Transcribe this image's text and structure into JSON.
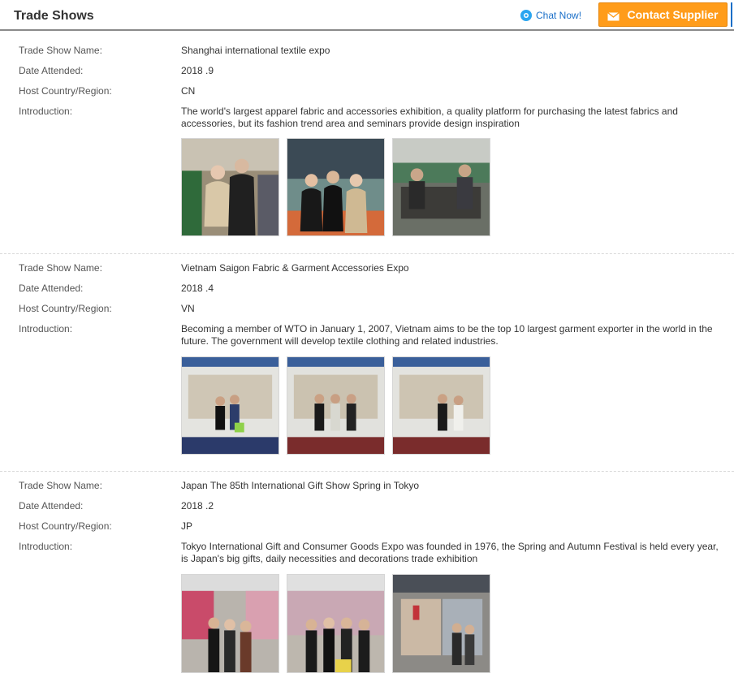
{
  "header": {
    "title": "Trade Shows",
    "chat_label": "Chat Now!",
    "contact_label": "Contact Supplier",
    "icons": {
      "chat": "chat-bubble-icon",
      "contact": "envelope-icon"
    },
    "colors": {
      "accent": "#ff9c1a",
      "link": "#1a6fc8"
    }
  },
  "labels": {
    "name": "Trade Show Name:",
    "date": "Date Attended:",
    "country": "Host Country/Region:",
    "intro": "Introduction:"
  },
  "shows": [
    {
      "name": "Shanghai international textile expo",
      "date": "2018 .9",
      "country": "CN",
      "intro": "The world's largest apparel fabric and accessories exhibition, a quality platform for purchasing the latest fabrics and accessories, but its fashion trend area and seminars provide design inspiration"
    },
    {
      "name": "Vietnam Saigon Fabric & Garment Accessories Expo",
      "date": "2018 .4",
      "country": "VN",
      "intro": "Becoming a member of WTO in January 1, 2007, Vietnam aims to be the top 10 largest garment exporter in the world in the future. The government will develop textile clothing and related industries."
    },
    {
      "name": "Japan The 85th International Gift Show Spring in Tokyo",
      "date": "2018 .2",
      "country": "JP",
      "intro": "Tokyo International Gift and Consumer Goods Expo was founded in 1976, the Spring and Autumn Festival is held every year, is Japan's big gifts, daily necessities and decorations trade exhibition"
    }
  ]
}
